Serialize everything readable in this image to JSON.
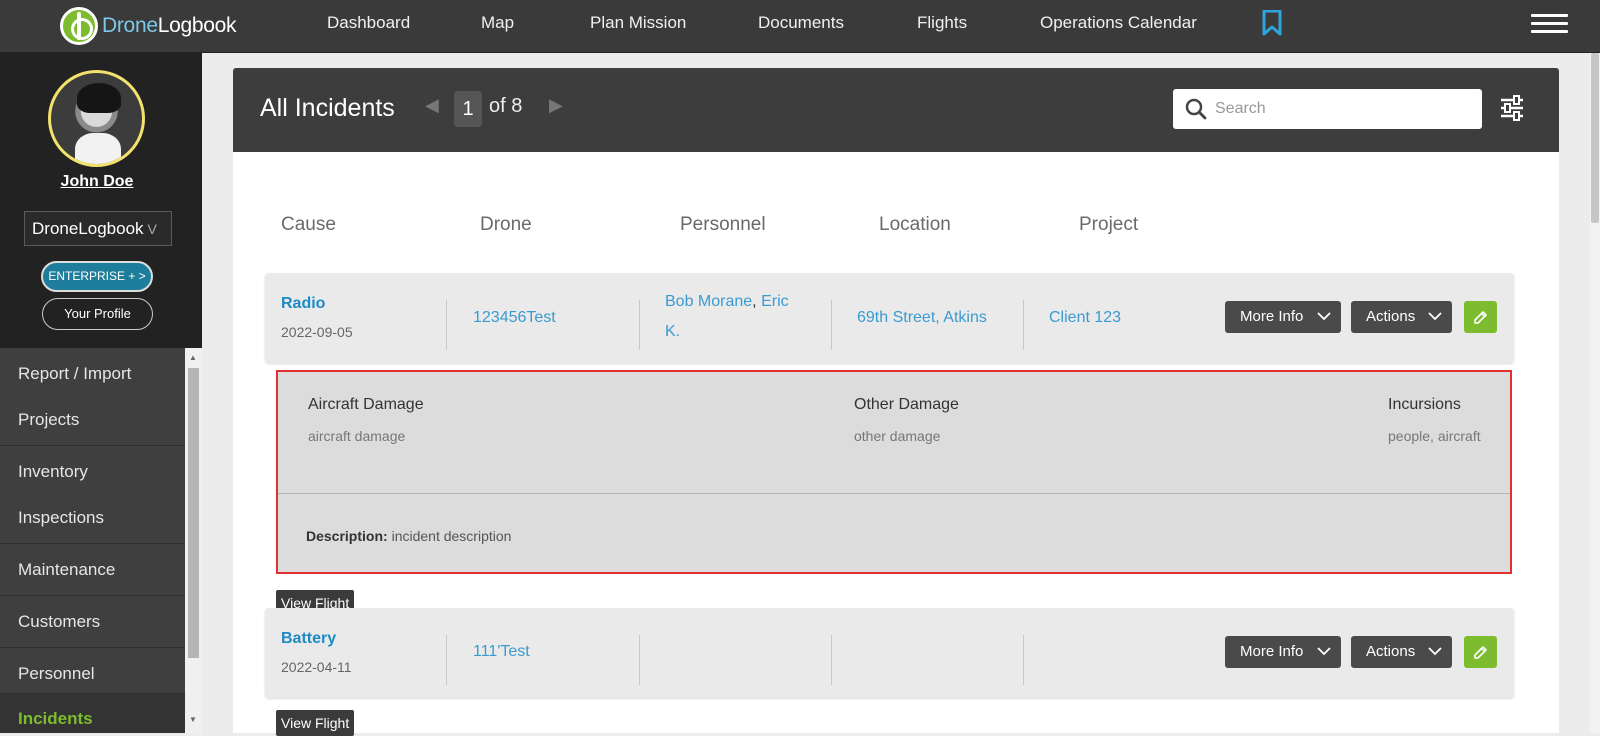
{
  "app": {
    "logo_part1": "Drone",
    "logo_part2": "Logbook"
  },
  "nav": {
    "items": [
      "Dashboard",
      "Map",
      "Plan Mission",
      "Documents",
      "Flights",
      "Operations Calendar"
    ],
    "bookmark_icon": "bookmark-icon",
    "menu_icon": "hamburger-icon"
  },
  "sidebar": {
    "user_name": "John Doe",
    "org_selected": "DroneLogbook",
    "org_caret": "V",
    "enterprise_label": "ENTERPRISE + >",
    "profile_label": "Your Profile",
    "menu": [
      "Report / Import",
      "Projects",
      "Inventory",
      "Inspections",
      "Maintenance",
      "Customers",
      "Personnel",
      "Incidents"
    ],
    "active_item": "Incidents"
  },
  "header": {
    "title": "All Incidents",
    "page_current": "1",
    "page_total_text": "of 8",
    "prev_glyph": "◀",
    "next_glyph": "▶",
    "search_placeholder": "Search"
  },
  "columns": [
    "Cause",
    "Drone",
    "Personnel",
    "Location",
    "Project"
  ],
  "incidents": [
    {
      "cause": "Radio",
      "date": "2022-09-05",
      "drone": "123456Test",
      "personnel_1": "Bob Morane",
      "personnel_sep": ",",
      "personnel_2a": "Eric",
      "personnel_2b": "K.",
      "location": "69th Street, Atkins",
      "project": "Client 123"
    },
    {
      "cause": "Battery",
      "date": "2022-04-11",
      "drone": "111'Test",
      "personnel": "",
      "location": "",
      "project": ""
    }
  ],
  "buttons": {
    "more_info": "More Info",
    "actions": "Actions",
    "view_flight": "View Flight"
  },
  "detail": {
    "aircraft_damage_label": "Aircraft Damage",
    "aircraft_damage_value": "aircraft damage",
    "other_damage_label": "Other Damage",
    "other_damage_value": "other damage",
    "incursions_label": "Incursions",
    "incursions_value": "people, aircraft",
    "description_label": "Description:",
    "description_value": "incident description"
  },
  "colors": {
    "accent_blue": "#1e8bc3",
    "accent_green": "#7dbb2f",
    "highlight_border": "#e03030"
  }
}
